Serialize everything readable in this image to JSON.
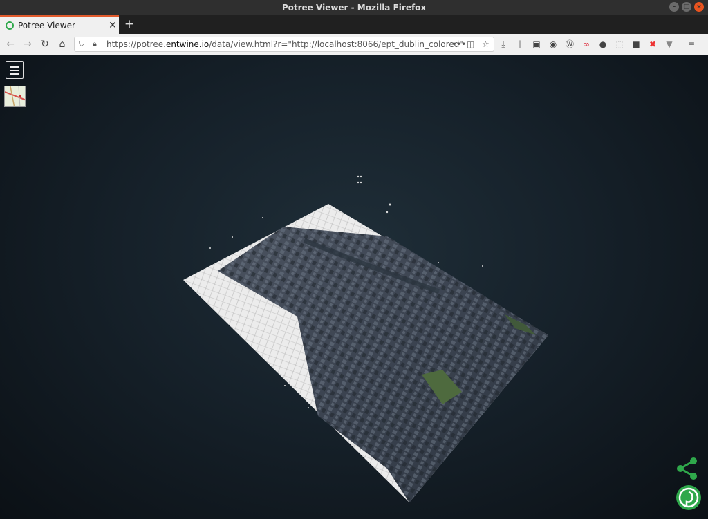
{
  "window": {
    "title": "Potree Viewer - Mozilla Firefox"
  },
  "tab": {
    "label": "Potree Viewer",
    "close": "✕",
    "new_tab": "+"
  },
  "nav": {
    "back": "←",
    "forward": "→",
    "reload": "↻",
    "home": "⌂",
    "url_prefix": "https://potree.",
    "url_domain": "entwine.io",
    "url_suffix": "/data/view.html?r=\"http://localhost:8066/ept_dublin_colored\"",
    "more": "•••",
    "star": "☆"
  },
  "toolbar_icons": [
    "downloads-icon",
    "library-icon",
    "sidebar-icon",
    "extension-icon",
    "wappalyzer-icon",
    "glasses-icon",
    "account-icon",
    "screenshot-icon",
    "selenium-icon",
    "tools-icon",
    "vuejs-icon",
    "menu-icon"
  ],
  "viewer": {
    "scene": "Dublin colored point cloud, oblique aerial view",
    "menu_label": "☰",
    "colors": {
      "background_center": "#1f2e38",
      "background_edge": "#0b1015",
      "accent_green": "#2fa84b"
    }
  }
}
